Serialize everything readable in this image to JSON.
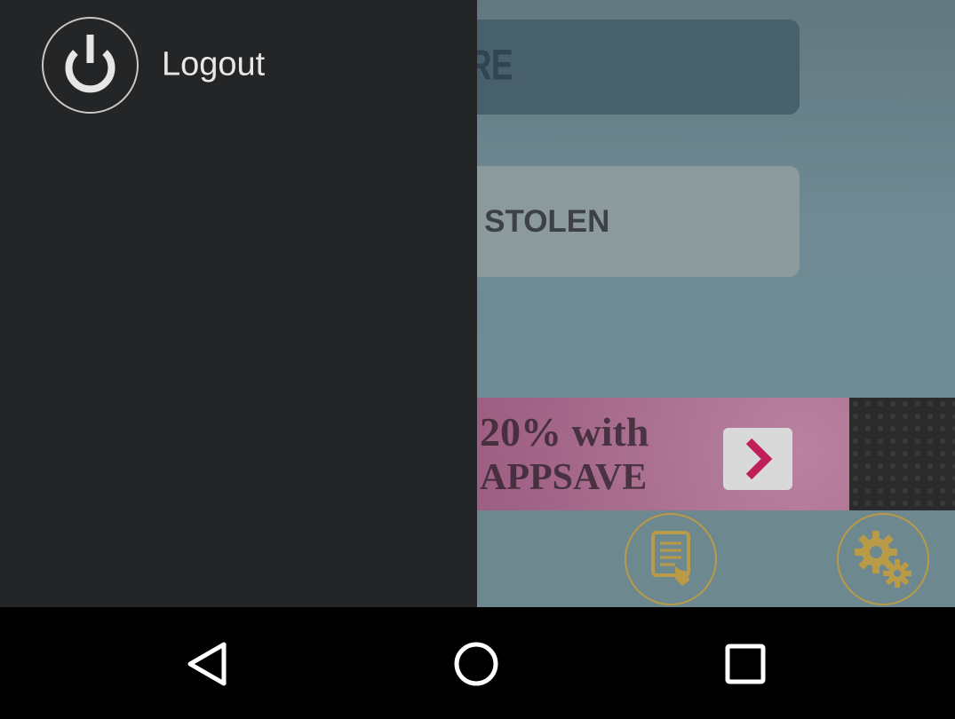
{
  "background_screen": {
    "primary_button_text": "HERE",
    "secondary_button_text": "F STOLEN",
    "ad": {
      "line1": "20% with",
      "line2": "APPSAVE",
      "go_icon": "chevron-right-icon"
    },
    "bottom_icons": [
      "document-tap-icon",
      "gears-icon"
    ],
    "accent_color": "#b99a47"
  },
  "drawer": {
    "items": [
      {
        "label": "Logout",
        "icon": "power-icon"
      }
    ]
  },
  "nav_bar": {
    "buttons": [
      "back-icon",
      "home-icon",
      "recents-icon"
    ]
  }
}
